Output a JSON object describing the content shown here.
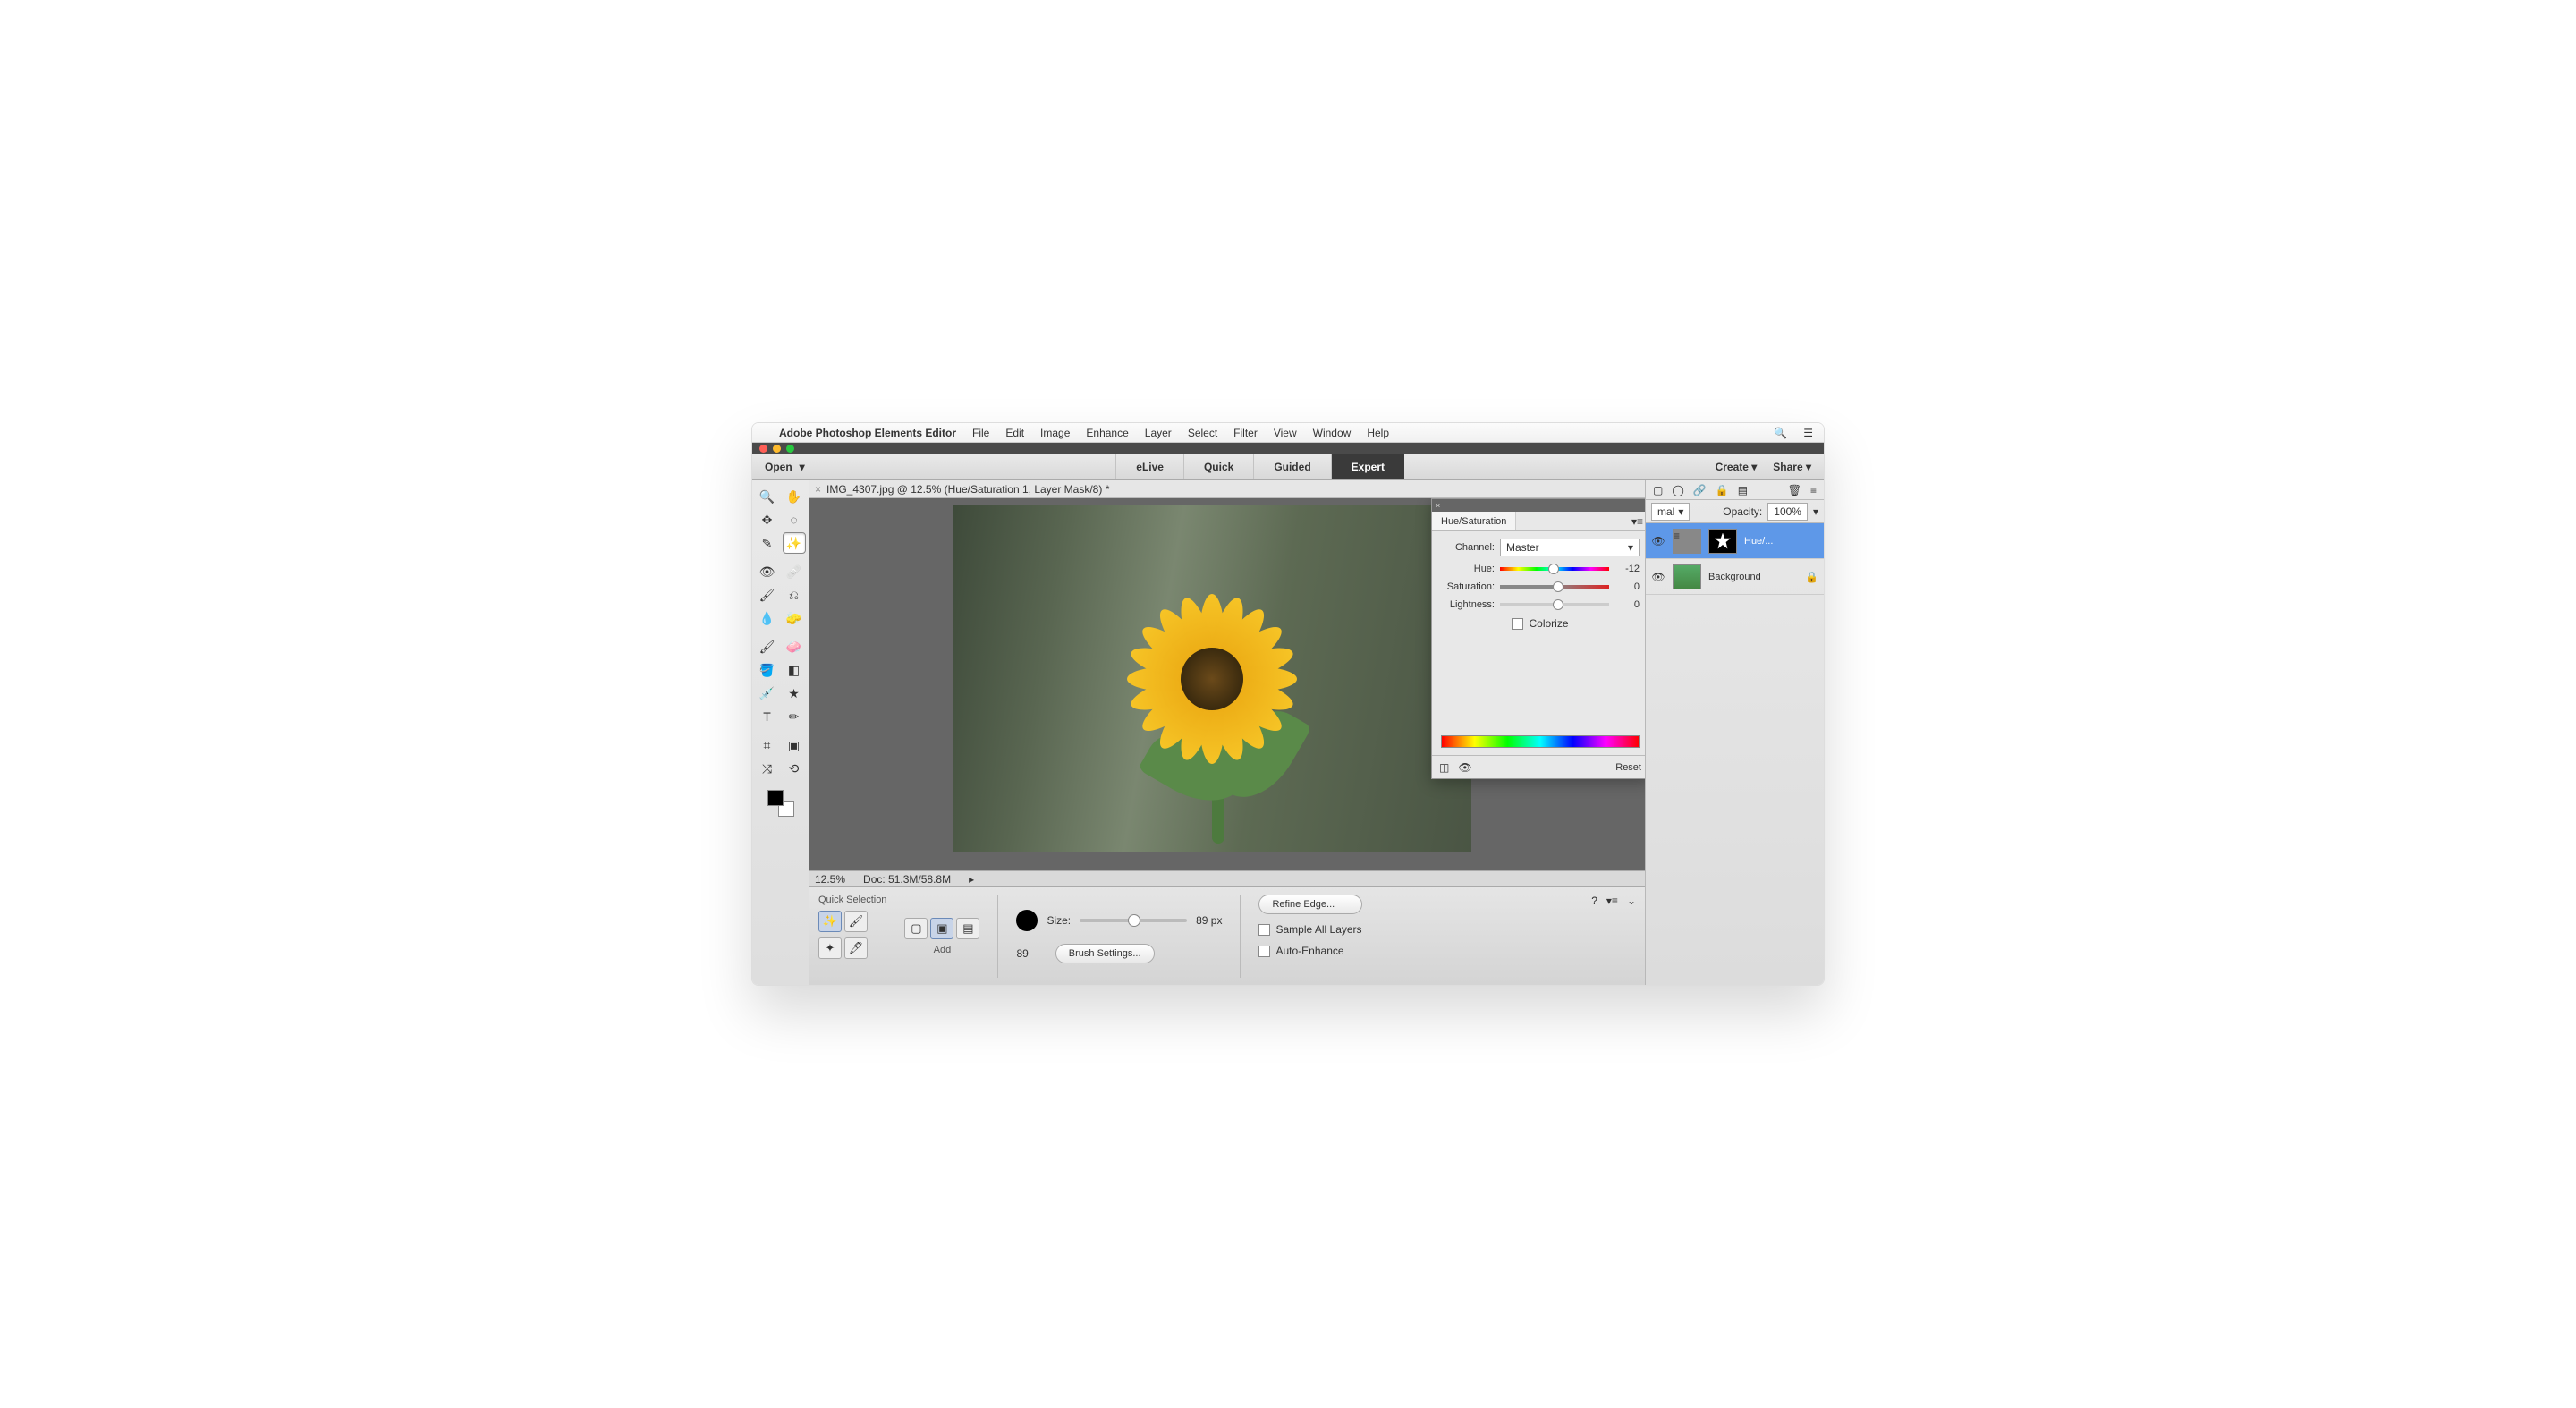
{
  "menubar": {
    "app_title": "Adobe Photoshop Elements Editor",
    "items": [
      "File",
      "Edit",
      "Image",
      "Enhance",
      "Layer",
      "Select",
      "Filter",
      "View",
      "Window",
      "Help"
    ]
  },
  "topbar": {
    "open": "Open",
    "modes": [
      "eLive",
      "Quick",
      "Guided",
      "Expert"
    ],
    "active_mode": "Expert",
    "create": "Create",
    "share": "Share"
  },
  "document": {
    "tab_title": "IMG_4307.jpg @ 12.5% (Hue/Saturation 1, Layer Mask/8) *",
    "zoom": "12.5%",
    "doc_size": "Doc: 51.3M/58.8M"
  },
  "options": {
    "tool_name": "Quick Selection",
    "mode_label": "Add",
    "size_label": "Size:",
    "size_value": "89 px",
    "size_num": "89",
    "brush_settings": "Brush Settings...",
    "refine_edge": "Refine Edge...",
    "sample_all": "Sample All Layers",
    "auto_enhance": "Auto-Enhance"
  },
  "layers": {
    "blend_mode": "mal",
    "opacity_label": "Opacity:",
    "opacity_value": "100%",
    "layer1_name": "Hue/...",
    "layer2_name": "Background"
  },
  "hue_panel": {
    "title": "Hue/Saturation",
    "channel_label": "Channel:",
    "channel_value": "Master",
    "hue_label": "Hue:",
    "hue_value": "-12",
    "sat_label": "Saturation:",
    "sat_value": "0",
    "light_label": "Lightness:",
    "light_value": "0",
    "colorize": "Colorize",
    "reset": "Reset"
  }
}
